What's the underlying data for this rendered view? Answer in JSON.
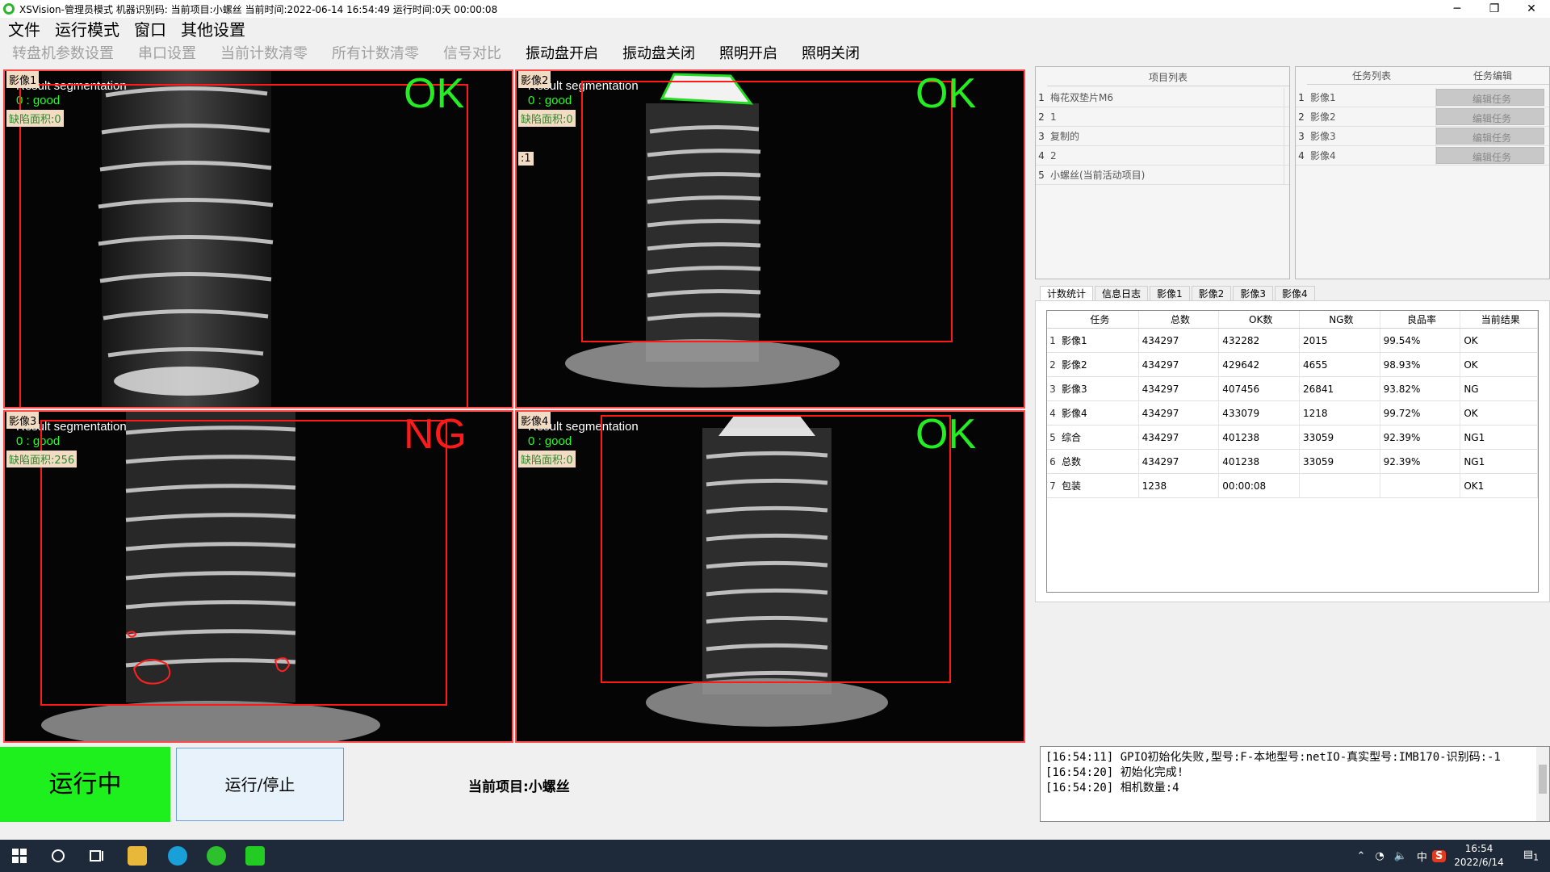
{
  "title": "XSVision-管理员模式 机器识别码: 当前项目:小螺丝 当前时间:2022-06-14 16:54:49 运行时间:0天 00:00:08",
  "window_buttons": [
    "─",
    "❐",
    "✕"
  ],
  "menu": [
    "文件",
    "运行模式",
    "窗口",
    "其他设置"
  ],
  "toolbar": {
    "disabled": [
      "转盘机参数设置",
      "串口设置",
      "当前计数清零",
      "所有计数清零",
      "信号对比"
    ],
    "enabled": [
      "振动盘开启",
      "振动盘关闭",
      "照明开启",
      "照明关闭"
    ]
  },
  "cameras": [
    {
      "title": "影像1",
      "result": "Result segmentation",
      "good": "0 : good",
      "defect": "缺陷面积:0",
      "verdict": "OK",
      "verdict_color": "#22ee22"
    },
    {
      "title": "影像2",
      "result": "Result segmentation",
      "good": "0 : good",
      "defect": "缺陷面积:0",
      "verdict": "OK",
      "verdict_color": "#22ee22",
      "tag": ":1"
    },
    {
      "title": "影像3",
      "result": "Result segmentation",
      "good": "0 : good",
      "defect": "缺陷面积:256",
      "verdict": "NG",
      "verdict_color": "#ff1a1a"
    },
    {
      "title": "影像4",
      "result": "Result segmentation",
      "good": "0 : good",
      "defect": "缺陷面积:0",
      "verdict": "OK",
      "verdict_color": "#22ee22"
    }
  ],
  "projects": {
    "header": "项目列表",
    "rows": [
      "梅花双垫片M6",
      "1",
      "复制的",
      "2",
      "小螺丝(当前活动项目)"
    ]
  },
  "tasks": {
    "header": "任务列表",
    "edit_header": "任务编辑",
    "rows": [
      "影像1",
      "影像2",
      "影像3",
      "影像4"
    ],
    "edit_label": "编辑任务"
  },
  "tabs": [
    "计数统计",
    "信息日志",
    "影像1",
    "影像2",
    "影像3",
    "影像4"
  ],
  "stats": {
    "headers": [
      "任务",
      "总数",
      "OK数",
      "NG数",
      "良品率",
      "当前结果"
    ],
    "rows": [
      [
        "影像1",
        "434297",
        "432282",
        "2015",
        "99.54%",
        "OK"
      ],
      [
        "影像2",
        "434297",
        "429642",
        "4655",
        "98.93%",
        "OK"
      ],
      [
        "影像3",
        "434297",
        "407456",
        "26841",
        "93.82%",
        "NG"
      ],
      [
        "影像4",
        "434297",
        "433079",
        "1218",
        "99.72%",
        "OK"
      ],
      [
        "综合",
        "434297",
        "401238",
        "33059",
        "92.39%",
        "NG1"
      ],
      [
        "总数",
        "434297",
        "401238",
        "33059",
        "92.39%",
        "NG1"
      ],
      [
        "包装",
        "1238",
        "00:00:08",
        "",
        "",
        "OK1"
      ]
    ]
  },
  "run_state": "运行中",
  "run_button": "运行/停止",
  "current_project": "当前项目:小螺丝",
  "log": [
    "[16:54:11] GPIO初始化失败,型号:F-本地型号:netIO-真实型号:IMB170-识别码:-1",
    "[16:54:20] 初始化完成!",
    "[16:54:20] 相机数量:4"
  ],
  "taskbar": {
    "ime": "中",
    "time": "16:54",
    "date": "2022/6/14",
    "notifications": "1"
  }
}
